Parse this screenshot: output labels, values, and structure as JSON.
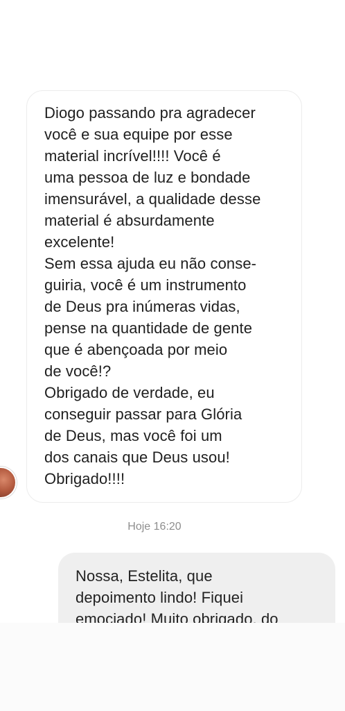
{
  "conversation": {
    "incoming_message": {
      "lines": [
        "Diogo passando pra agradecer",
        "você e sua equipe por esse",
        "material incrível!!!! Você é",
        "uma pessoa de luz e bondade",
        "imensurável, a qualidade desse",
        "material é absurdamente",
        "excelente!",
        "Sem essa ajuda eu não conse-",
        "guiria, você é um instrumento",
        "de Deus pra inúmeras vidas,",
        "pense na quantidade de gente",
        "que é abençoada por meio",
        "de você!?",
        "Obrigado de verdade, eu",
        "conseguir passar para Glória",
        "de Deus, mas você foi um",
        "dos canais que Deus usou!",
        "Obrigado!!!!"
      ]
    },
    "timestamp": "Hoje 16:20",
    "outgoing_message": {
      "lines": [
        "Nossa, Estelita, que",
        "depoimento lindo! Fiquei",
        "emociado! Muito obrigado, do"
      ]
    }
  }
}
